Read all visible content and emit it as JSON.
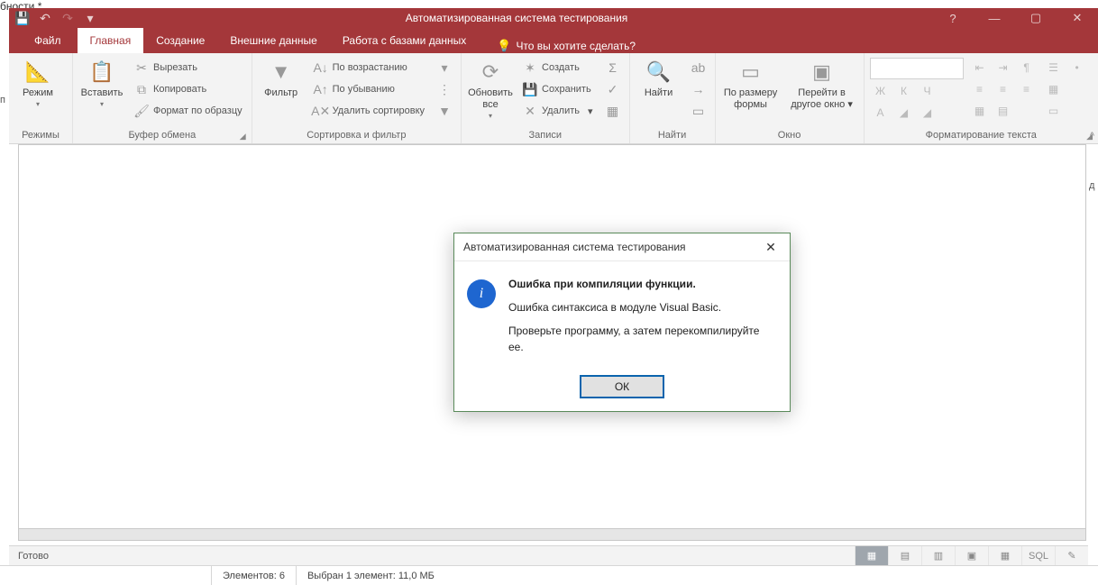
{
  "fragment_text": "бности *",
  "qat": {
    "save": "💾",
    "undo": "↶",
    "redo": "↷",
    "more": "▾"
  },
  "title": "Автоматизированная система тестирования",
  "window_buttons": {
    "help": "?",
    "min": "—",
    "max": "▢",
    "close": "✕"
  },
  "tabs": {
    "file": "Файл",
    "home": "Главная",
    "create": "Создание",
    "external": "Внешние данные",
    "dbtools": "Работа с базами данных",
    "tellme": "Что вы хотите сделать?"
  },
  "ribbon": {
    "views": {
      "view": "Режим",
      "group": "Режимы"
    },
    "clipboard": {
      "paste": "Вставить",
      "cut": "Вырезать",
      "copy": "Копировать",
      "painter": "Формат по образцу",
      "group": "Буфер обмена"
    },
    "sort": {
      "filter": "Фильтр",
      "asc": "По возрастанию",
      "desc": "По убыванию",
      "remove": "Удалить сортировку",
      "group": "Сортировка и фильтр"
    },
    "records": {
      "refresh": "Обновить все",
      "new": "Создать",
      "save": "Сохранить",
      "delete": "Удалить",
      "group": "Записи"
    },
    "find": {
      "find": "Найти",
      "group": "Найти"
    },
    "window": {
      "fit": "По размеру формы",
      "switch": "Перейти в другое окно",
      "group": "Окно"
    },
    "format": {
      "group": "Форматирование текста",
      "bold": "Ж",
      "italic": "К",
      "underline": "Ч",
      "fontcolor": "А"
    }
  },
  "dialog": {
    "title": "Автоматизированная система тестирования",
    "heading": "Ошибка при компиляции функции.",
    "line1": "Ошибка синтаксиса в модуле Visual Basic.",
    "line2": "Проверьте программу, а затем перекомпилируйте ее.",
    "ok": "ОК"
  },
  "status": {
    "ready": "Готово",
    "sql": "SQL"
  },
  "osbar": {
    "items": "Элементов: 6",
    "selected": "Выбран 1 элемент: 11,0 МБ"
  },
  "left_edge": "п",
  "right_edge": "д"
}
